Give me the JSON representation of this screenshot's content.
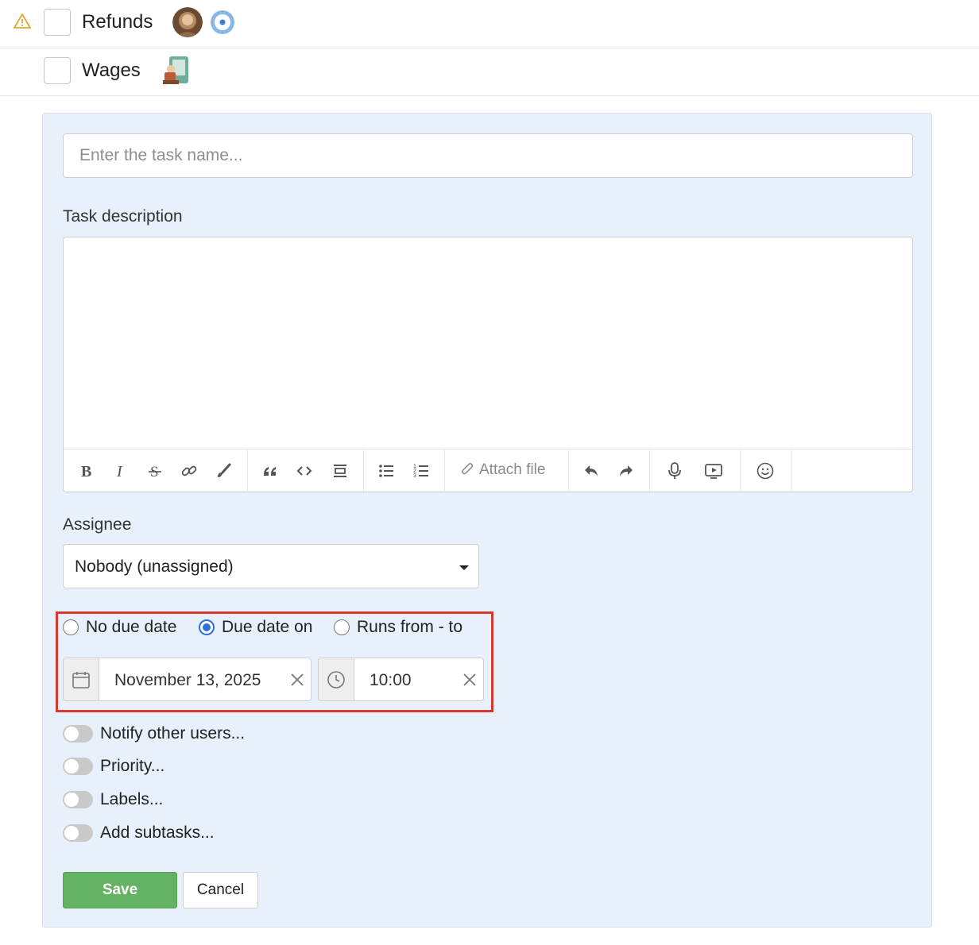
{
  "tasks": [
    {
      "title": "Refunds",
      "has_warning": true,
      "avatar": "woman-avatar",
      "extra_icon": "target-icon"
    },
    {
      "title": "Wages",
      "has_warning": false,
      "avatar": "cartoon-avatar"
    }
  ],
  "form": {
    "task_name_placeholder": "Enter the task name...",
    "description_label": "Task description",
    "toolbar": {
      "buttons": [
        "bold-icon",
        "italic-icon",
        "strikethrough-icon",
        "link-icon",
        "brush-icon",
        "quote-icon",
        "code-icon",
        "align-center-icon",
        "bullet-list-icon",
        "numbered-list-icon",
        "undo-icon",
        "redo-icon",
        "microphone-icon",
        "video-icon",
        "emoji-icon"
      ],
      "attach_label": "Attach file"
    },
    "assignee_label": "Assignee",
    "assignee_value": "Nobody (unassigned)",
    "due_options": [
      {
        "label": "No due date",
        "checked": false
      },
      {
        "label": "Due date on",
        "checked": true
      },
      {
        "label": "Runs from - to",
        "checked": false
      }
    ],
    "due_date": "November 13, 2025",
    "due_time": "10:00",
    "toggles": [
      {
        "label": "Notify other users...",
        "on": false
      },
      {
        "label": "Priority...",
        "on": false
      },
      {
        "label": "Labels...",
        "on": false
      },
      {
        "label": "Add subtasks...",
        "on": false
      }
    ],
    "save_label": "Save",
    "cancel_label": "Cancel"
  },
  "colors": {
    "panel_bg": "#e8f1fb",
    "save_green": "#64b264",
    "radio_blue": "#2d6fdb",
    "highlight_red": "#d9382f",
    "warning_yellow": "#e0a92e"
  }
}
